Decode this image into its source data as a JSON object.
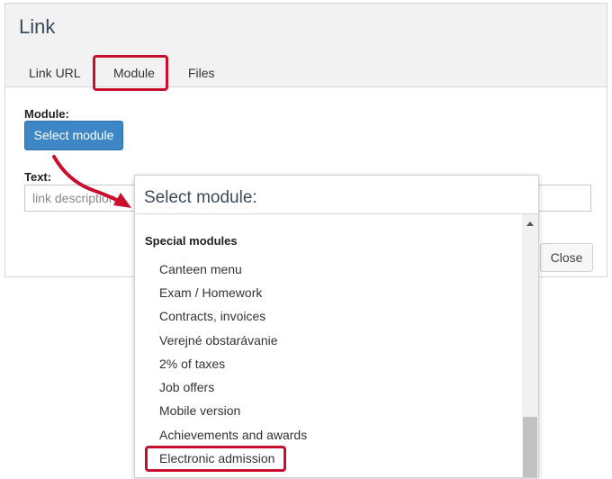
{
  "dialog": {
    "title": "Link",
    "tabs": [
      {
        "label": "Link URL"
      },
      {
        "label": "Module"
      },
      {
        "label": "Files"
      }
    ],
    "module_label": "Module:",
    "select_module_button": "Select module",
    "text_label": "Text:",
    "text_placeholder": "link description",
    "close_button": "Close"
  },
  "popup": {
    "title": "Select module:",
    "section": "Special modules",
    "items": [
      {
        "label": "Canteen menu"
      },
      {
        "label": "Exam / Homework"
      },
      {
        "label": "Contracts, invoices"
      },
      {
        "label": "Verejné obstarávanie"
      },
      {
        "label": "2% of taxes"
      },
      {
        "label": "Job offers"
      },
      {
        "label": "Mobile version"
      },
      {
        "label": "Achievements and awards"
      },
      {
        "label": "Electronic admission"
      }
    ]
  },
  "colors": {
    "accent": "#3d87c7",
    "highlight": "#c8102e"
  }
}
